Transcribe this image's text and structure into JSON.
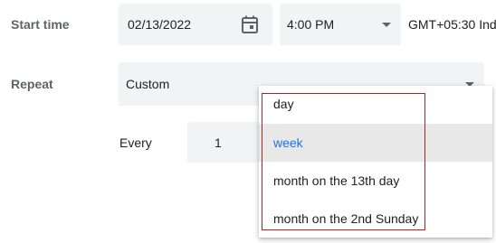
{
  "start_time": {
    "label": "Start time",
    "date": "02/13/2022",
    "time": "4:00 PM",
    "timezone": "GMT+05:30 Indi"
  },
  "repeat": {
    "label": "Repeat",
    "value": "Custom",
    "every_label": "Every",
    "interval": "1"
  },
  "dropdown": {
    "options": [
      "day",
      "week",
      "month on the 13th day",
      "month on the 2nd Sunday"
    ],
    "selected": "week"
  },
  "icons": {
    "date_picker": "calendar-icon",
    "time_caret": "chevron-down-icon",
    "repeat_caret": "chevron-down-icon"
  },
  "colors": {
    "field_bg": "#f1f3f4",
    "selected_text": "#1a73e8",
    "selected_bg": "#e8e8e8",
    "annotation_border": "#b22222"
  }
}
